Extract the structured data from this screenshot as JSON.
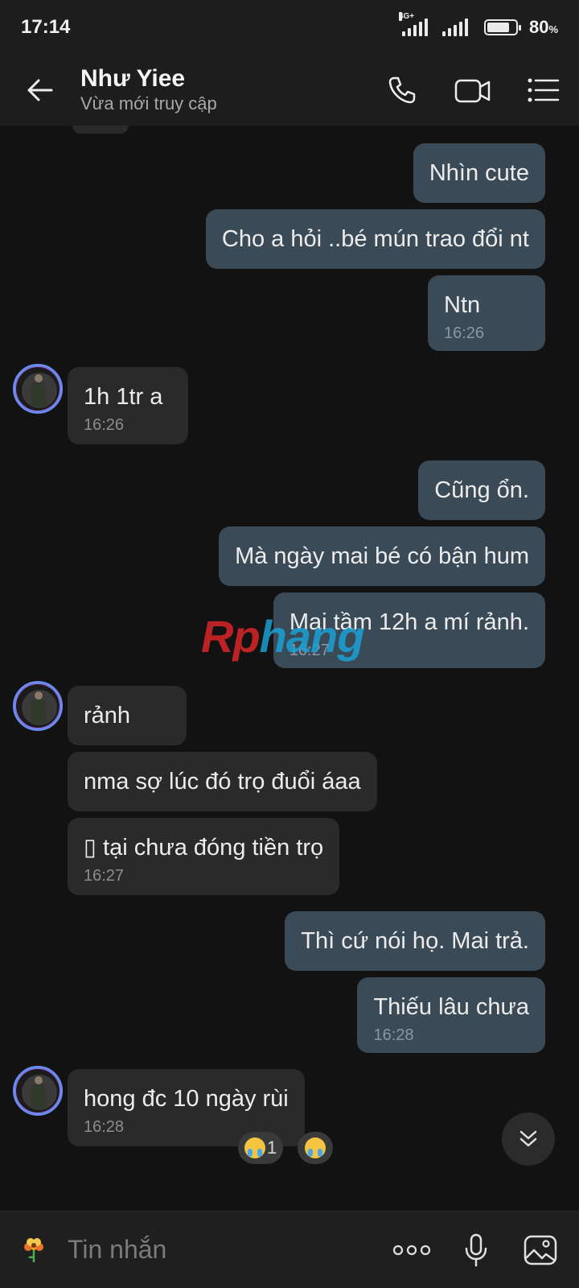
{
  "status_bar": {
    "time": "17:14",
    "network": "4G+",
    "battery": "80",
    "battery_unit": "%",
    "battery_level": 0.8
  },
  "header": {
    "contact_name": "Như Yiee",
    "contact_status": "Vừa mới truy cập",
    "icons": [
      "back-arrow-icon",
      "phone-icon",
      "video-call-icon",
      "menu-list-icon"
    ]
  },
  "messages": [
    {
      "dir": "out",
      "text": "Nhìn cute",
      "time": ""
    },
    {
      "dir": "out",
      "text": "Cho a hỏi ..bé mún trao đổi nt",
      "time": ""
    },
    {
      "dir": "out",
      "text": "Ntn",
      "time": "16:26"
    },
    {
      "dir": "in",
      "text": "1h 1tr a",
      "time": "16:26"
    },
    {
      "dir": "out",
      "text": "Cũng ổn.",
      "time": ""
    },
    {
      "dir": "out",
      "text": "Mà ngày mai bé có bận hum",
      "time": ""
    },
    {
      "dir": "out",
      "text": "Mai tầm 12h a mí rảnh.",
      "time": "16:27"
    },
    {
      "dir": "in",
      "text": "rảnh",
      "time": ""
    },
    {
      "dir": "in",
      "text": "nma sợ lúc đó trọ đuổi áaa",
      "time": ""
    },
    {
      "dir": "in",
      "text": "▯ tại chưa đóng tiền trọ",
      "time": "16:27"
    },
    {
      "dir": "out",
      "text": "Thì cứ nói họ.  Mai trả.",
      "time": ""
    },
    {
      "dir": "out",
      "text": "Thiếu lâu chưa",
      "time": "16:28"
    },
    {
      "dir": "in",
      "text": "hong đc 10 ngày rùi",
      "time": "16:28"
    }
  ],
  "reactions": [
    {
      "emoji": "crying-face-emoji",
      "count": "1"
    },
    {
      "emoji": "crying-face-emoji",
      "count": ""
    }
  ],
  "watermark": {
    "part1": "Rp",
    "part2": "hang"
  },
  "composer": {
    "placeholder": "Tin nhắn",
    "icons": [
      "sticker-icon",
      "more-icon",
      "microphone-icon",
      "image-icon"
    ]
  },
  "colors": {
    "background": "#121212",
    "outgoing_bubble": "#3b4a57",
    "incoming_bubble": "#2a2a2a"
  }
}
